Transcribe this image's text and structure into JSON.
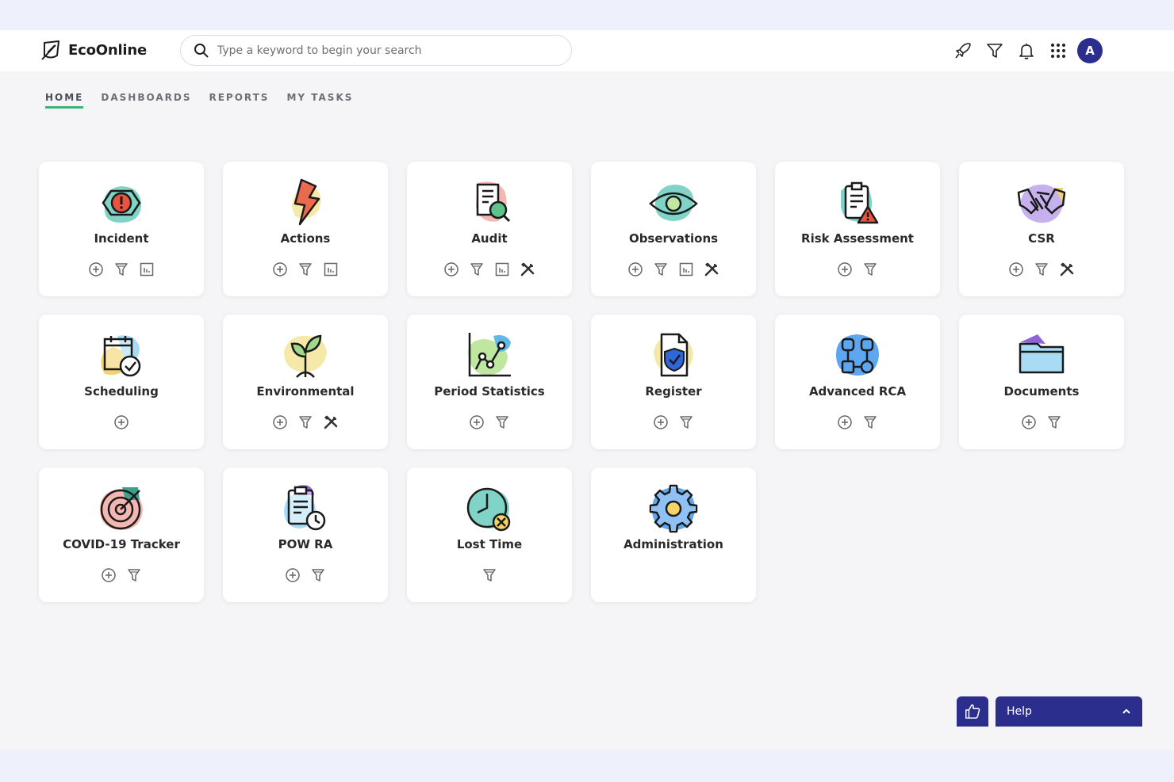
{
  "app": {
    "name": "EcoOnline"
  },
  "search": {
    "placeholder": "Type a keyword to begin your search"
  },
  "topbar": {
    "icons": [
      "rocket-icon",
      "filter-icon",
      "bell-icon",
      "apps-grid-icon"
    ],
    "avatar_initial": "A",
    "accent": "#2b2e8c"
  },
  "nav": {
    "tabs": [
      {
        "label": "HOME",
        "active": true
      },
      {
        "label": "DASHBOARDS",
        "active": false
      },
      {
        "label": "REPORTS",
        "active": false
      },
      {
        "label": "MY TASKS",
        "active": false
      }
    ],
    "active_color": "#3cb36e"
  },
  "tiles": [
    {
      "title": "Incident",
      "icon": "incident-icon",
      "actions": [
        "add",
        "filter",
        "report"
      ]
    },
    {
      "title": "Actions",
      "icon": "actions-icon",
      "actions": [
        "add",
        "filter",
        "report"
      ]
    },
    {
      "title": "Audit",
      "icon": "audit-icon",
      "actions": [
        "add",
        "filter",
        "report",
        "tools"
      ]
    },
    {
      "title": "Observations",
      "icon": "observations-icon",
      "actions": [
        "add",
        "filter",
        "report",
        "tools"
      ]
    },
    {
      "title": "Risk Assessment",
      "icon": "risk-assessment-icon",
      "actions": [
        "add",
        "filter"
      ]
    },
    {
      "title": "CSR",
      "icon": "csr-icon",
      "actions": [
        "add",
        "filter",
        "tools"
      ]
    },
    {
      "title": "Scheduling",
      "icon": "scheduling-icon",
      "actions": [
        "add"
      ]
    },
    {
      "title": "Environmental",
      "icon": "environmental-icon",
      "actions": [
        "add",
        "filter",
        "tools"
      ]
    },
    {
      "title": "Period Statistics",
      "icon": "period-statistics-icon",
      "actions": [
        "add",
        "filter"
      ]
    },
    {
      "title": "Register",
      "icon": "register-icon",
      "actions": [
        "add",
        "filter"
      ]
    },
    {
      "title": "Advanced RCA",
      "icon": "advanced-rca-icon",
      "actions": [
        "add",
        "filter"
      ]
    },
    {
      "title": "Documents",
      "icon": "documents-icon",
      "actions": [
        "add",
        "filter"
      ]
    },
    {
      "title": "COVID-19 Tracker",
      "icon": "covid-tracker-icon",
      "actions": [
        "add",
        "filter"
      ]
    },
    {
      "title": "POW RA",
      "icon": "pow-ra-icon",
      "actions": [
        "add",
        "filter"
      ]
    },
    {
      "title": "Lost Time",
      "icon": "lost-time-icon",
      "actions": [
        "filter"
      ]
    },
    {
      "title": "Administration",
      "icon": "administration-icon",
      "actions": []
    }
  ],
  "footer": {
    "help_label": "Help",
    "like_icon": "thumbs-up-icon",
    "help_toggle_icon": "chevron-up-icon"
  }
}
